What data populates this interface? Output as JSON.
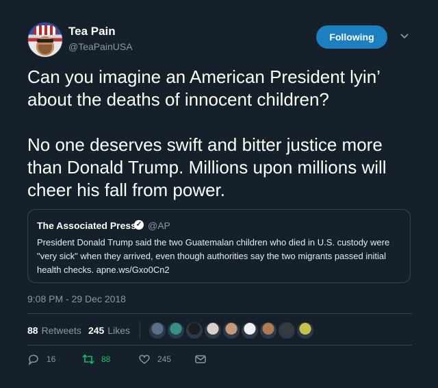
{
  "author": {
    "name": "Tea Pain",
    "handle": "@TeaPainUSA"
  },
  "follow_button_label": "Following",
  "tweet_text": "Can you imagine an American President lyin’ about the deaths of innocent children?\n\nNo one deserves swift and bitter justice more than Donald Trump. Millions upon millions will cheer his fall from power.",
  "quoted_tweet": {
    "name": "The Associated Press",
    "handle": "@AP",
    "text": "President Donald Trump said the two Guatemalan children who died in U.S. custody were \"very sick\" when they arrived, even though authorities say the two migrants passed initial health checks. apne.ws/Gxo0Cn2"
  },
  "timestamp": "9:08 PM - 29 Dec 2018",
  "stats": {
    "retweets_count": "88",
    "retweets_label": "Retweets",
    "likes_count": "245",
    "likes_label": "Likes"
  },
  "liker_avatar_colors": [
    "#5b6e8a",
    "#3a8e8a",
    "#1d1d1d",
    "#d9d0c8",
    "#c49a7a",
    "#f0f0f0",
    "#b07a55",
    "#3a3a3a",
    "#c9c24a"
  ],
  "actions": {
    "reply_count": "16",
    "retweet_count": "88",
    "like_count": "245"
  },
  "colors": {
    "background": "#15202b",
    "accent": "#1b95e0",
    "secondary_text": "#8899a6",
    "retweet_green": "#17bf63"
  }
}
